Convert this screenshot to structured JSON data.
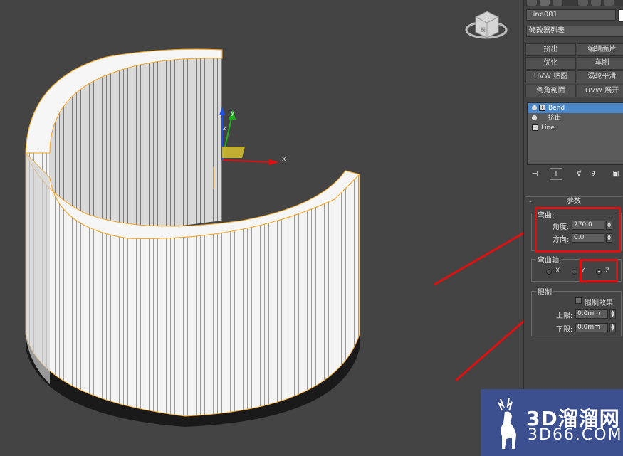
{
  "object_name": "Line001",
  "modifier_list_label": "修改器列表",
  "modifier_buttons": [
    "挤出",
    "编辑面片",
    "优化",
    "车削",
    "UVW 贴图",
    "涡轮平滑",
    "倒角剖面",
    "UVW 展开"
  ],
  "stack": {
    "items": [
      {
        "label": "Bend",
        "selected": true
      },
      {
        "label": "挤出",
        "selected": false
      },
      {
        "label": "Line",
        "selected": false
      }
    ]
  },
  "params": {
    "rollout_title": "参数",
    "collapse_symbol": "-",
    "bend_group": "弯曲:",
    "angle_label": "角度:",
    "angle_value": "270.0",
    "direction_label": "方向:",
    "direction_value": "0.0",
    "bend_axis_group": "弯曲轴:",
    "axis_x": "X",
    "axis_y": "Y",
    "axis_z": "Z",
    "selected_axis": "Z",
    "limits_group": "限制",
    "limit_effect_label": "限制效果",
    "upper_label": "上限:",
    "upper_value": "0.0mm",
    "lower_label": "下限:",
    "lower_value": "0.0mm"
  },
  "gizmo": {
    "x": "x",
    "y": "y",
    "z": "z"
  },
  "viewcube_labels": {
    "top": "上",
    "front": "前"
  },
  "watermark": {
    "line1": "3D溜溜网",
    "line2": "3D66.COM"
  },
  "colors": {
    "highlight_red": "#e01010",
    "selection_blue": "#4a86c8",
    "wireframe_orange": "#f5a623"
  }
}
